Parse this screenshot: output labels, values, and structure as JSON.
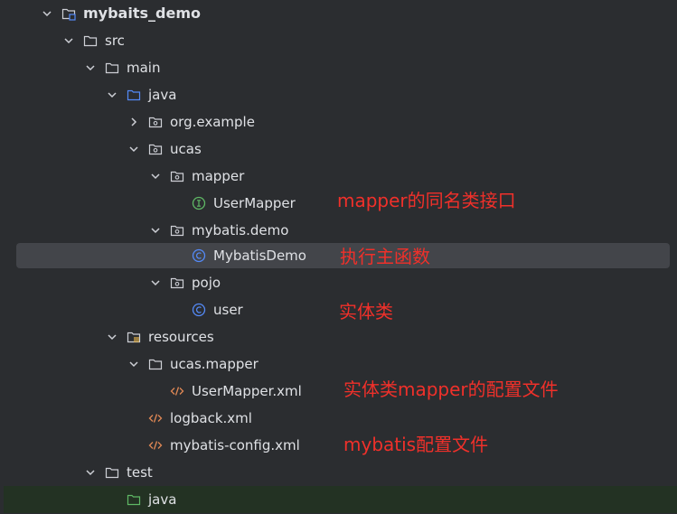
{
  "tree": {
    "rows": [
      {
        "label": "mybaits_demo",
        "icon": "module-folder-icon",
        "chevron": "down"
      },
      {
        "label": "src",
        "icon": "folder-icon",
        "chevron": "down"
      },
      {
        "label": "main",
        "icon": "folder-icon",
        "chevron": "down"
      },
      {
        "label": "java",
        "icon": "source-folder-icon",
        "chevron": "down"
      },
      {
        "label": "org.example",
        "icon": "package-icon",
        "chevron": "right"
      },
      {
        "label": "ucas",
        "icon": "package-icon",
        "chevron": "down"
      },
      {
        "label": "mapper",
        "icon": "package-icon",
        "chevron": "down"
      },
      {
        "label": "UserMapper",
        "icon": "interface-icon",
        "chevron": "none"
      },
      {
        "label": "mybatis.demo",
        "icon": "package-icon",
        "chevron": "down"
      },
      {
        "label": "MybatisDemo",
        "icon": "class-icon",
        "chevron": "none",
        "selected": true
      },
      {
        "label": "pojo",
        "icon": "package-icon",
        "chevron": "down"
      },
      {
        "label": "user",
        "icon": "class-icon",
        "chevron": "none"
      },
      {
        "label": "resources",
        "icon": "resources-folder-icon",
        "chevron": "down"
      },
      {
        "label": "ucas.mapper",
        "icon": "folder-icon",
        "chevron": "down"
      },
      {
        "label": "UserMapper.xml",
        "icon": "xml-icon",
        "chevron": "none"
      },
      {
        "label": "logback.xml",
        "icon": "xml-icon",
        "chevron": "none"
      },
      {
        "label": "mybatis-config.xml",
        "icon": "xml-icon",
        "chevron": "none"
      },
      {
        "label": "test",
        "icon": "folder-icon",
        "chevron": "down"
      },
      {
        "label": "java",
        "icon": "test-folder-icon",
        "chevron": "none"
      }
    ]
  },
  "annotations": {
    "mapper_note": "mapper的同名类接口",
    "main_note": "执行主函数",
    "pojo_note": "实体类",
    "xml_note": "实体类mapper的配置文件",
    "config_note": "mybatis配置文件"
  },
  "colors": {
    "background": "#2b2d30",
    "selected_row": "#43454a",
    "test_row": "#233223",
    "annotation": "#f0302a",
    "folder_icon": "#ced0d6",
    "source_folder_icon": "#548af7",
    "test_folder_icon": "#5fb865",
    "class_icon": "#548af7",
    "interface_icon": "#5fb865",
    "xml_icon": "#e08855"
  }
}
